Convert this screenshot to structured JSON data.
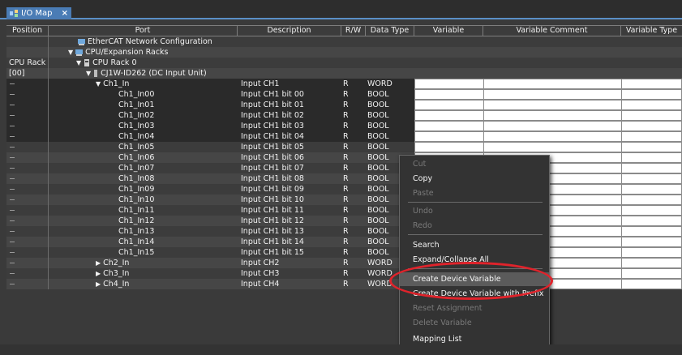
{
  "tab": {
    "title": "I/O Map",
    "close": "×"
  },
  "columns": {
    "position": "Position",
    "port": "Port",
    "description": "Description",
    "rw": "R/W",
    "data_type": "Data Type",
    "variable": "Variable",
    "variable_comment": "Variable Comment",
    "variable_type": "Variable Type"
  },
  "tree": {
    "ethercat": "EtherCAT Network Configuration",
    "racks": "CPU/Expansion Racks",
    "cpu_rack": "CPU Rack 0",
    "cpu_rack_pos": "CPU Rack",
    "unit_pos": "[00]",
    "unit": "CJ1W-ID262 (DC Input Unit)",
    "collapse_glyph": "▼",
    "expand_glyph": "▶"
  },
  "rows": [
    {
      "port": "Ch1_In",
      "desc": "Input CH1",
      "rw": "R",
      "type": "WORD"
    },
    {
      "port": "Ch1_In00",
      "desc": "Input CH1 bit 00",
      "rw": "R",
      "type": "BOOL"
    },
    {
      "port": "Ch1_In01",
      "desc": "Input CH1 bit 01",
      "rw": "R",
      "type": "BOOL"
    },
    {
      "port": "Ch1_In02",
      "desc": "Input CH1 bit 02",
      "rw": "R",
      "type": "BOOL"
    },
    {
      "port": "Ch1_In03",
      "desc": "Input CH1 bit 03",
      "rw": "R",
      "type": "BOOL"
    },
    {
      "port": "Ch1_In04",
      "desc": "Input CH1 bit 04",
      "rw": "R",
      "type": "BOOL"
    },
    {
      "port": "Ch1_In05",
      "desc": "Input CH1 bit 05",
      "rw": "R",
      "type": "BOOL"
    },
    {
      "port": "Ch1_In06",
      "desc": "Input CH1 bit 06",
      "rw": "R",
      "type": "BOOL"
    },
    {
      "port": "Ch1_In07",
      "desc": "Input CH1 bit 07",
      "rw": "R",
      "type": "BOOL"
    },
    {
      "port": "Ch1_In08",
      "desc": "Input CH1 bit 08",
      "rw": "R",
      "type": "BOOL"
    },
    {
      "port": "Ch1_In09",
      "desc": "Input CH1 bit 09",
      "rw": "R",
      "type": "BOOL"
    },
    {
      "port": "Ch1_In10",
      "desc": "Input CH1 bit 10",
      "rw": "R",
      "type": "BOOL"
    },
    {
      "port": "Ch1_In11",
      "desc": "Input CH1 bit 11",
      "rw": "R",
      "type": "BOOL"
    },
    {
      "port": "Ch1_In12",
      "desc": "Input CH1 bit 12",
      "rw": "R",
      "type": "BOOL"
    },
    {
      "port": "Ch1_In13",
      "desc": "Input CH1 bit 13",
      "rw": "R",
      "type": "BOOL"
    },
    {
      "port": "Ch1_In14",
      "desc": "Input CH1 bit 14",
      "rw": "R",
      "type": "BOOL"
    },
    {
      "port": "Ch1_In15",
      "desc": "Input CH1 bit 15",
      "rw": "R",
      "type": "BOOL"
    },
    {
      "port": "Ch2_In",
      "desc": "Input CH2",
      "rw": "R",
      "type": "WORD"
    },
    {
      "port": "Ch3_In",
      "desc": "Input CH3",
      "rw": "R",
      "type": "WORD"
    },
    {
      "port": "Ch4_In",
      "desc": "Input CH4",
      "rw": "R",
      "type": "WORD"
    }
  ],
  "context_menu": {
    "cut": "Cut",
    "copy": "Copy",
    "paste": "Paste",
    "undo": "Undo",
    "redo": "Redo",
    "search": "Search",
    "expand_collapse": "Expand/Collapse All",
    "create_device_variable": "Create Device Variable",
    "create_device_variable_prefix": "Create Device Variable with Prefix",
    "reset_assignment": "Reset Assignment",
    "delete_variable": "Delete Variable",
    "mapping_list": "Mapping List"
  },
  "colors": {
    "accent": "#4a7cb5",
    "highlight_ellipse": "#e0232b",
    "background": "#3a3a3a"
  }
}
